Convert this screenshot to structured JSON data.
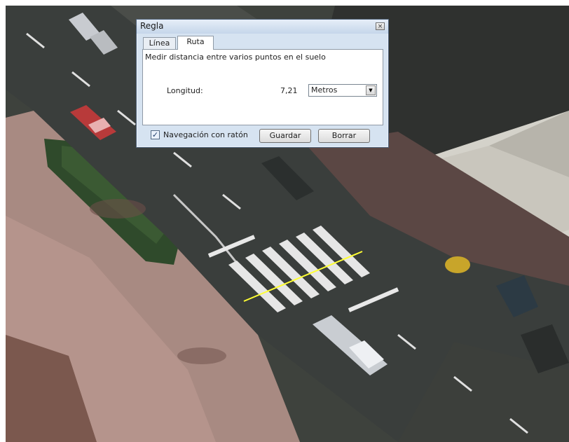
{
  "dialog": {
    "title": "Regla",
    "close_glyph": "×",
    "tabs": [
      {
        "label": "Línea",
        "selected": false
      },
      {
        "label": "Ruta",
        "selected": true
      }
    ],
    "description": "Medir distancia entre varios puntos en el suelo",
    "length_label": "Longitud:",
    "length_value": "7,21",
    "unit_selected": "Metros",
    "dropdown_glyph": "▼",
    "mouse_nav_label": "Navegación con ratón",
    "mouse_nav_checked": true,
    "check_glyph": "✓",
    "save_label": "Guardar",
    "clear_label": "Borrar"
  },
  "colors": {
    "measure_line": "#ffff33",
    "dialog_frame": "#d6e3f1"
  }
}
